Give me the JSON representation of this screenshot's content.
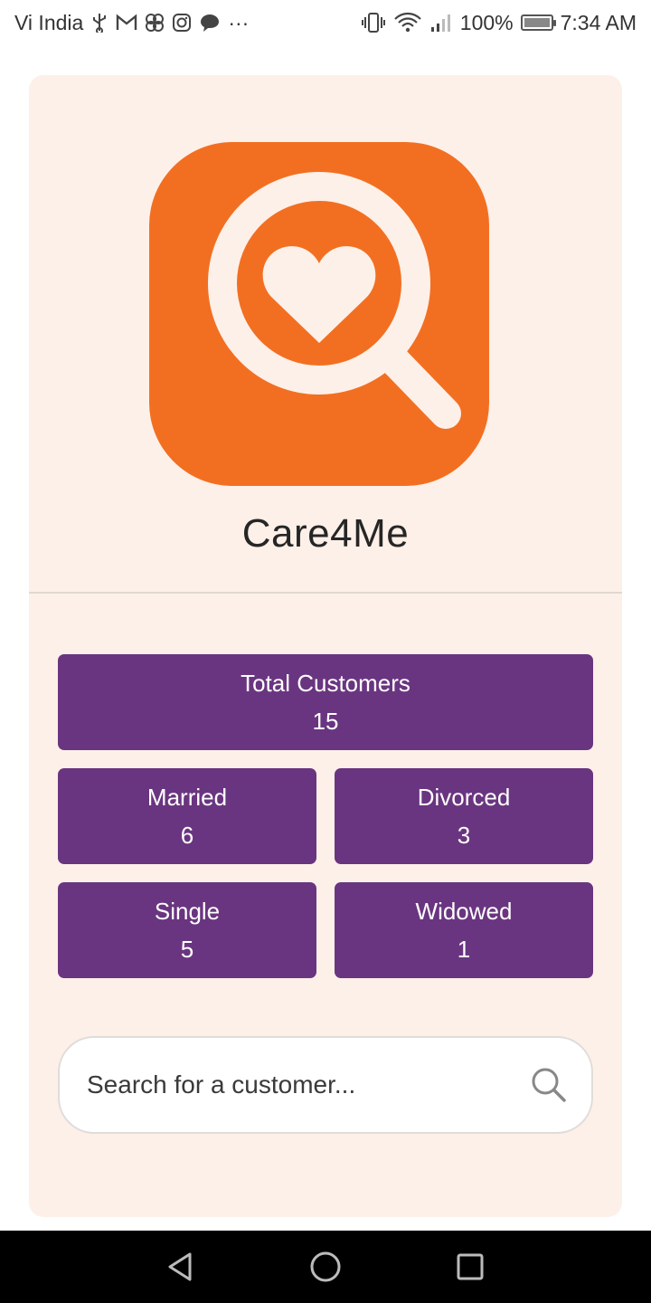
{
  "status_bar": {
    "carrier": "Vi India",
    "battery": "100%",
    "time": "7:34 AM",
    "more": "···"
  },
  "app": {
    "name": "Care4Me",
    "brand_color": "#f26f22",
    "accent_color": "#6a3580",
    "card_bg": "#fdf0e8"
  },
  "stats": {
    "total": {
      "label": "Total Customers",
      "value": "15"
    },
    "married": {
      "label": "Married",
      "value": "6"
    },
    "divorced": {
      "label": "Divorced",
      "value": "3"
    },
    "single": {
      "label": "Single",
      "value": "5"
    },
    "widowed": {
      "label": "Widowed",
      "value": "1"
    }
  },
  "search": {
    "placeholder": "Search for a customer...",
    "icon": "search-icon"
  },
  "nav": {
    "back": "back-triangle-icon",
    "home": "home-circle-icon",
    "recents": "recents-square-icon"
  }
}
